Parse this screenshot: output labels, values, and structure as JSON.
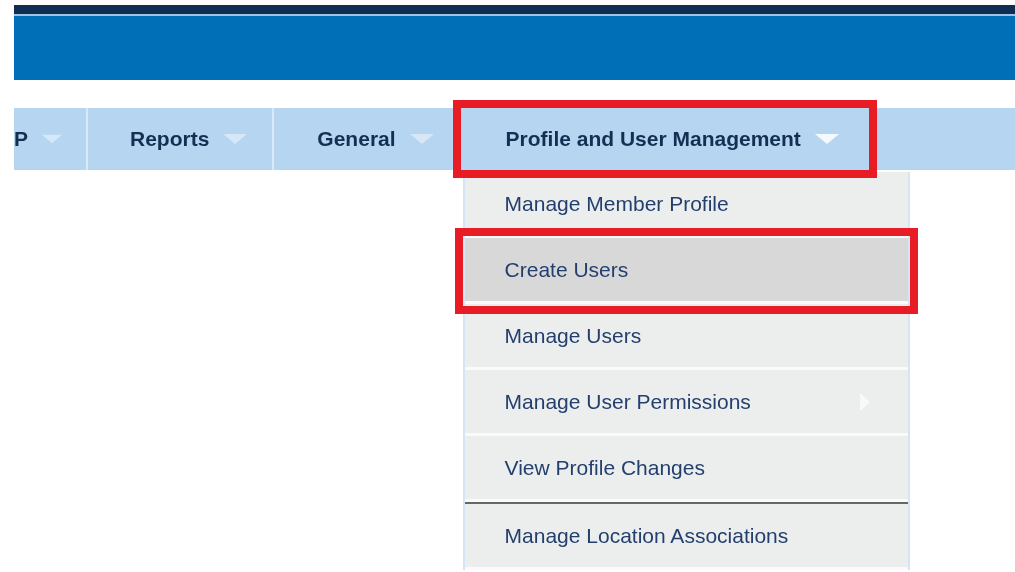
{
  "menu_bar": {
    "tabs": [
      {
        "label": "P",
        "annotated": false,
        "open": false
      },
      {
        "label": "Reports",
        "annotated": false,
        "open": false
      },
      {
        "label": "General",
        "annotated": false,
        "open": false
      },
      {
        "label": "Profile and User Management",
        "annotated": true,
        "open": true,
        "items": [
          {
            "label": "Manage Member Profile",
            "selected": false,
            "annotated": false,
            "has_submenu": false,
            "separator_before": false
          },
          {
            "label": "Create Users",
            "selected": true,
            "annotated": true,
            "has_submenu": false,
            "separator_before": false
          },
          {
            "label": "Manage Users",
            "selected": false,
            "annotated": false,
            "has_submenu": false,
            "separator_before": false
          },
          {
            "label": "Manage User Permissions",
            "selected": false,
            "annotated": false,
            "has_submenu": true,
            "separator_before": false
          },
          {
            "label": "View Profile Changes",
            "selected": false,
            "annotated": false,
            "has_submenu": false,
            "separator_before": false
          },
          {
            "label": "Manage Location Associations",
            "selected": false,
            "annotated": false,
            "has_submenu": false,
            "separator_before": true
          }
        ]
      }
    ]
  }
}
